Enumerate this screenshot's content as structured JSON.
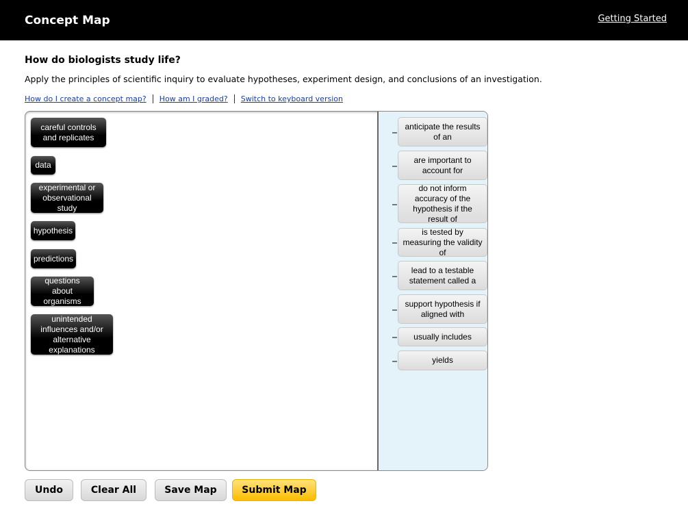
{
  "header": {
    "title": "Concept Map",
    "getting_started": "Getting Started"
  },
  "question": "How do biologists study life?",
  "description": "Apply the principles of scientific inquiry to evaluate hypotheses, experiment design, and conclusions of an investigation.",
  "help_links": [
    "How do I create a concept map?",
    "How am I graded?",
    "Switch to keyboard version"
  ],
  "concepts": [
    "careful controls and replicates",
    "data",
    "experimental or observational study",
    "hypothesis",
    "predictions",
    "questions about organisms",
    "unintended influences and/or alternative explanations"
  ],
  "linking_phrases": [
    "anticipate the results of an",
    "are important to account for",
    "do not inform accuracy of the hypothesis if the result of",
    "is tested by measuring the validity of",
    "lead to a testable statement called a",
    "support hypothesis if aligned with",
    "usually includes",
    "yields"
  ],
  "buttons": {
    "undo": "Undo",
    "clear_all": "Clear All",
    "save_map": "Save Map",
    "submit_map": "Submit Map"
  },
  "colors": {
    "accent": "#fcbc00",
    "panel": "#e4f3f9"
  }
}
